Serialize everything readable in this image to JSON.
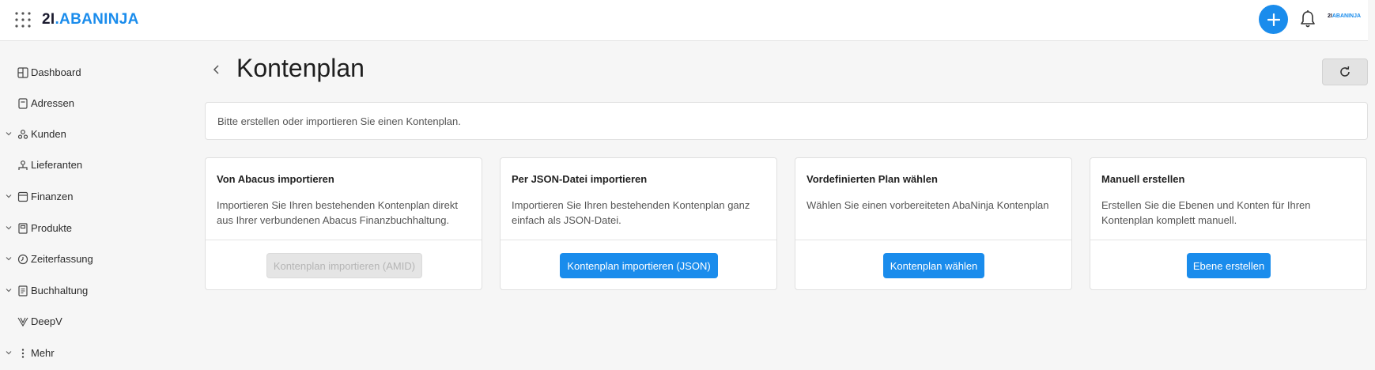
{
  "header": {
    "logo_num": "2I",
    "logo_dot": ".",
    "logo_brand": "ABANINJA",
    "mini_logo_num": "2I",
    "mini_logo_brand": "ABANINJA",
    "accent_color": "#1a8cec",
    "icons": [
      "apps-grid-icon",
      "plus-icon",
      "bell-icon"
    ]
  },
  "sidebar": {
    "items": [
      {
        "label": "Dashboard",
        "icon": "dashboard-icon",
        "expandable": false
      },
      {
        "label": "Adressen",
        "icon": "address-book-icon",
        "expandable": false
      },
      {
        "label": "Kunden",
        "icon": "customers-icon",
        "expandable": true
      },
      {
        "label": "Lieferanten",
        "icon": "suppliers-icon",
        "expandable": false
      },
      {
        "label": "Finanzen",
        "icon": "finance-icon",
        "expandable": true
      },
      {
        "label": "Produkte",
        "icon": "products-icon",
        "expandable": true
      },
      {
        "label": "Zeiterfassung",
        "icon": "clock-icon",
        "expandable": true
      },
      {
        "label": "Buchhaltung",
        "icon": "accounting-icon",
        "expandable": true
      },
      {
        "label": "DeepV",
        "icon": "deepv-icon",
        "expandable": false
      },
      {
        "label": "Mehr",
        "icon": "more-vertical-icon",
        "expandable": true
      }
    ]
  },
  "main": {
    "title": "Kontenplan",
    "info": "Bitte erstellen oder importieren Sie einen Kontenplan.",
    "cards": [
      {
        "title": "Von Abacus importieren",
        "description": "Importieren Sie Ihren bestehenden Kontenplan direkt aus Ihrer verbundenen Abacus Finanzbuchhaltung.",
        "button": "Kontenplan importieren (AMID)",
        "disabled": true
      },
      {
        "title": "Per JSON-Datei importieren",
        "description": "Importieren Sie Ihren bestehenden Kontenplan ganz einfach als JSON-Datei.",
        "button": "Kontenplan importieren (JSON)",
        "disabled": false
      },
      {
        "title": "Vordefinierten Plan wählen",
        "description": "Wählen Sie einen vorbereiteten AbaNinja Kontenplan",
        "button": "Kontenplan wählen",
        "disabled": false
      },
      {
        "title": "Manuell erstellen",
        "description": "Erstellen Sie die Ebenen und Konten für Ihren Kontenplan komplett manuell.",
        "button": "Ebene erstellen",
        "disabled": false
      }
    ]
  }
}
